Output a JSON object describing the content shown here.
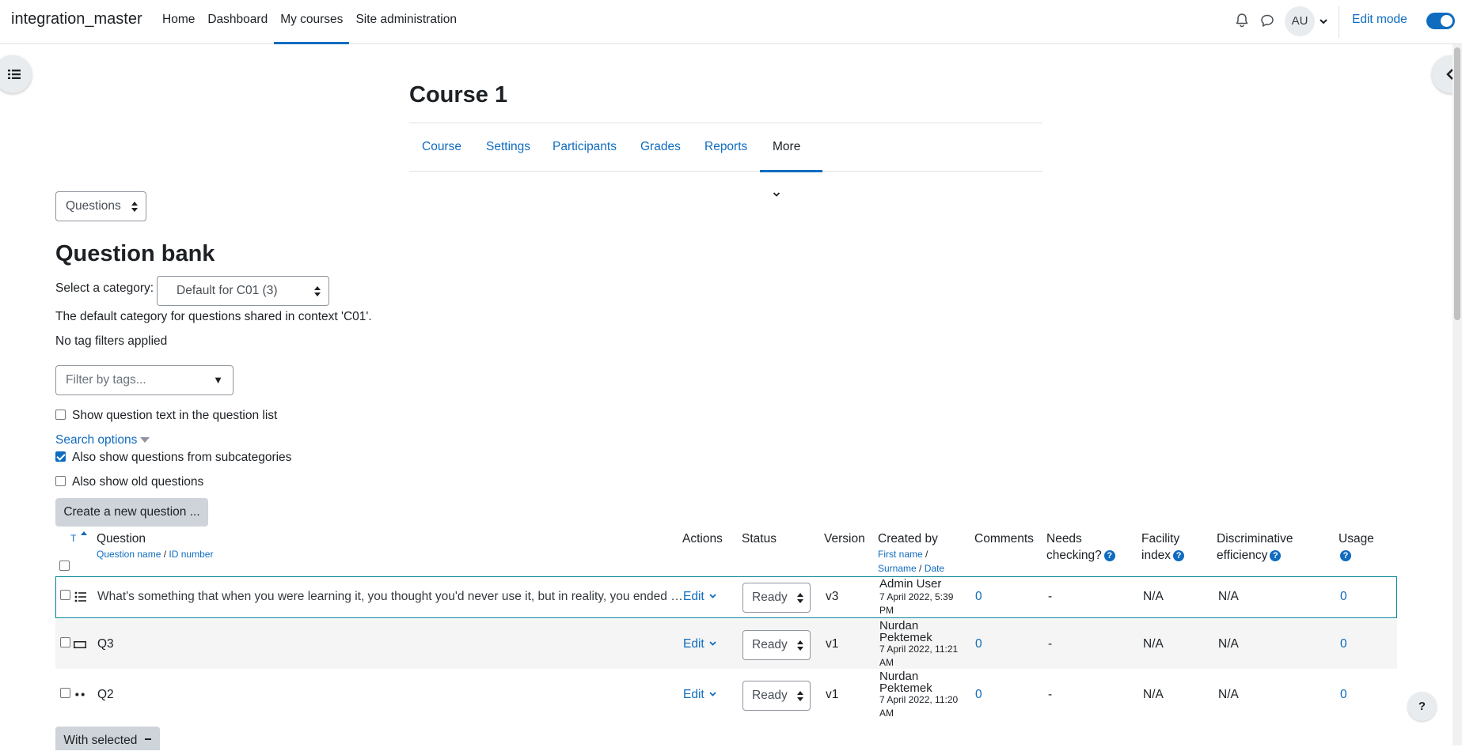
{
  "navbar": {
    "brand": "integration_master",
    "links": [
      {
        "label": "Home"
      },
      {
        "label": "Dashboard"
      },
      {
        "label": "My courses"
      },
      {
        "label": "Site administration"
      }
    ],
    "user_initials": "AU",
    "edit_mode_label": "Edit mode",
    "edit_mode_on": true
  },
  "course": {
    "title": "Course 1",
    "tabs": [
      "Course",
      "Settings",
      "Participants",
      "Grades",
      "Reports",
      "More"
    ]
  },
  "page_select": {
    "value": "Questions"
  },
  "question_bank": {
    "title": "Question bank",
    "category_label": "Select a category:",
    "category_value": "Default for C01 (3)",
    "category_description": "The default category for questions shared in context 'C01'.",
    "tag_status": "No tag filters applied",
    "tag_filter_placeholder": "Filter by tags...",
    "show_text_label": "Show question text in the question list",
    "search_options_label": "Search options",
    "subcategories_label": "Also show questions from subcategories",
    "old_questions_label": "Also show old questions",
    "create_button": "Create a new question ...",
    "with_selected_button": "With selected"
  },
  "table": {
    "headers": {
      "type": "T",
      "question": "Question",
      "question_name": "Question name",
      "id_number": "ID number",
      "actions": "Actions",
      "status": "Status",
      "version": "Version",
      "created_by": "Created by",
      "first_name": "First name",
      "surname": "Surname",
      "date": "Date",
      "comments": "Comments",
      "needs_checking_1": "Needs",
      "needs_checking_2": "checking?",
      "facility_1": "Facility",
      "facility_2": "index",
      "discriminative_1": "Discriminative",
      "discriminative_2": "efficiency",
      "usage": "Usage"
    },
    "rows": [
      {
        "icon": "multichoice-icon",
        "question": "What's something that when you were learning it, you thought you'd never use it, but in reality, you ended …",
        "action": "Edit",
        "status": "Ready",
        "version": "v3",
        "creator": "Admin User",
        "date_line1": "7 April 2022, 5:39",
        "date_line2": "PM",
        "comments": "0",
        "needs_checking": "-",
        "facility": "N/A",
        "discriminative": "N/A",
        "usage": "0"
      },
      {
        "icon": "shortanswer-icon",
        "question": "Q3",
        "action": "Edit",
        "status": "Ready",
        "version": "v1",
        "creator_line1": "Nurdan",
        "creator_line2": "Pektemek",
        "date_line1": "7 April 2022, 11:21",
        "date_line2": "AM",
        "comments": "0",
        "needs_checking": "-",
        "facility": "N/A",
        "discriminative": "N/A",
        "usage": "0"
      },
      {
        "icon": "truefalse-icon",
        "question": "Q2",
        "action": "Edit",
        "status": "Ready",
        "version": "v1",
        "creator_line1": "Nurdan",
        "creator_line2": "Pektemek",
        "date_line1": "7 April 2022, 11:20",
        "date_line2": "AM",
        "comments": "0",
        "needs_checking": "-",
        "facility": "N/A",
        "discriminative": "N/A",
        "usage": "0"
      }
    ]
  },
  "help_button": "?",
  "colors": {
    "accent": "#0f6cbf",
    "selected_row_border": "#008196",
    "stripe": "#f5f5f5"
  }
}
